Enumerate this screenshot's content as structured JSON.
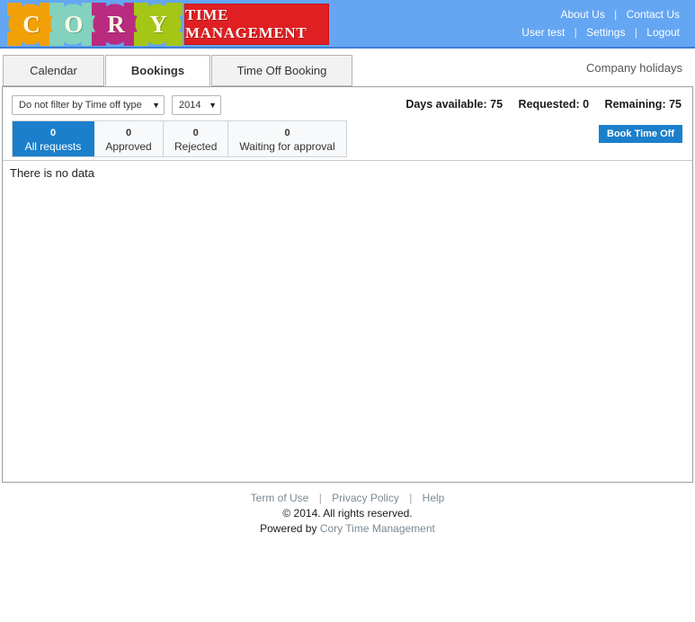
{
  "header": {
    "logo_letters": [
      {
        "char": "C",
        "color": "#f2a007"
      },
      {
        "char": "O",
        "color": "#82d2bd"
      },
      {
        "char": "R",
        "color": "#b92b7f"
      },
      {
        "char": "Y",
        "color": "#a5c614"
      }
    ],
    "brand_banner": "TIME MANAGEMENT",
    "brand_banner_color": "#e01f23",
    "background_color": "#64a6f2",
    "nav_top": [
      {
        "label": "About Us"
      },
      {
        "label": "Contact Us"
      }
    ],
    "nav_bottom": [
      {
        "label": "User test"
      },
      {
        "label": "Settings"
      },
      {
        "label": "Logout"
      }
    ],
    "separator": "|"
  },
  "tabs": [
    {
      "label": "Calendar",
      "active": false
    },
    {
      "label": "Bookings",
      "active": true
    },
    {
      "label": "Time Off Booking",
      "active": false
    }
  ],
  "company_holidays_link": "Company holidays",
  "filters": {
    "time_off_type": {
      "value": "Do not filter by Time off type",
      "caret": "▼"
    },
    "year": {
      "value": "2014",
      "caret": "▼"
    }
  },
  "stats": [
    {
      "label": "Days available:",
      "value": "75"
    },
    {
      "label": "Requested:",
      "value": "0"
    },
    {
      "label": "Remaining:",
      "value": "75"
    }
  ],
  "status_tabs": [
    {
      "count": "0",
      "label": "All requests",
      "active": true
    },
    {
      "count": "0",
      "label": "Approved",
      "active": false
    },
    {
      "count": "0",
      "label": "Rejected",
      "active": false
    },
    {
      "count": "0",
      "label": "Waiting for approval",
      "active": false
    }
  ],
  "book_button": "Book Time Off",
  "accent_color": "#1b7fcb",
  "table": {
    "empty_message": "There is no data"
  },
  "footer": {
    "links": [
      {
        "label": "Term of Use"
      },
      {
        "label": "Privacy Policy"
      },
      {
        "label": "Help"
      }
    ],
    "separator": "|",
    "copyright": "© 2014. All rights reserved.",
    "powered_prefix": "Powered by ",
    "powered_link": "Cory Time Management"
  }
}
